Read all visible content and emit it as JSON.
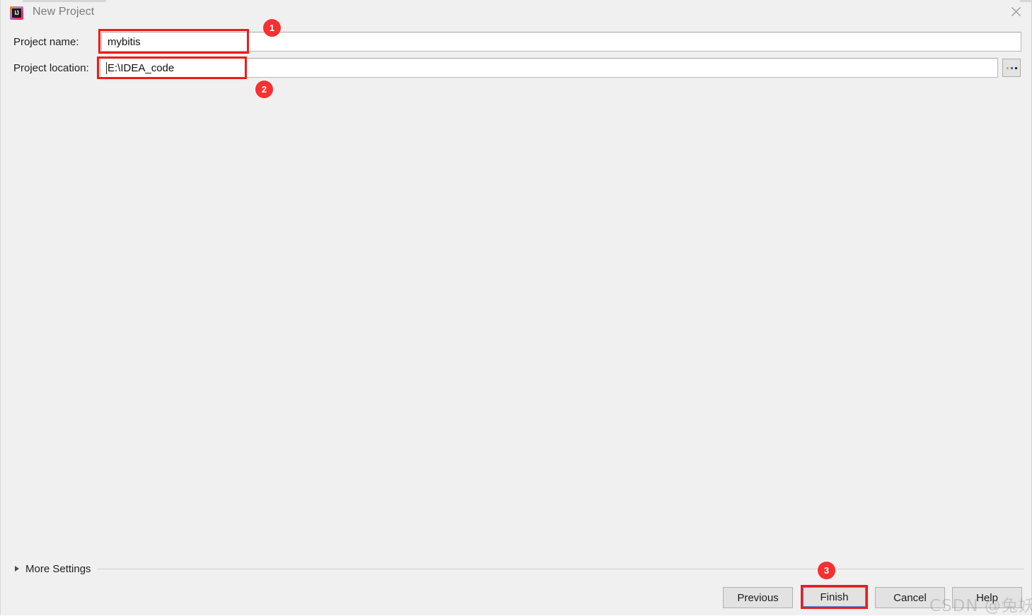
{
  "window": {
    "title": "New Project",
    "app_icon": "intellij-idea-icon",
    "icon_text": "IJ",
    "close_icon": "close-icon"
  },
  "form": {
    "name_label": "Project name:",
    "name_value": "mybitis",
    "name_placeholder": "",
    "location_label": "Project location:",
    "location_value": "E:\\IDEA_code",
    "location_placeholder": "",
    "browse_button_label": "...",
    "browse_icon": "ellipsis-icon"
  },
  "more_settings": {
    "label": "More Settings",
    "expanded": false,
    "arrow_icon": "chevron-right-icon"
  },
  "buttons": {
    "previous": "Previous",
    "finish": "Finish",
    "cancel": "Cancel",
    "help": "Help"
  },
  "annotations": {
    "badge_1": "1",
    "badge_2": "2",
    "badge_3": "3",
    "color": "#f73030",
    "box_color": "#f01a1a"
  },
  "watermark": {
    "text": "CSDN @兔妖阿"
  },
  "colors": {
    "dialog_background": "#f0f0f0",
    "field_background": "#ffffff",
    "button_background": "#e2e2e2",
    "focus_ring": "#3c93e0",
    "title_text": "#7a7a7a"
  }
}
